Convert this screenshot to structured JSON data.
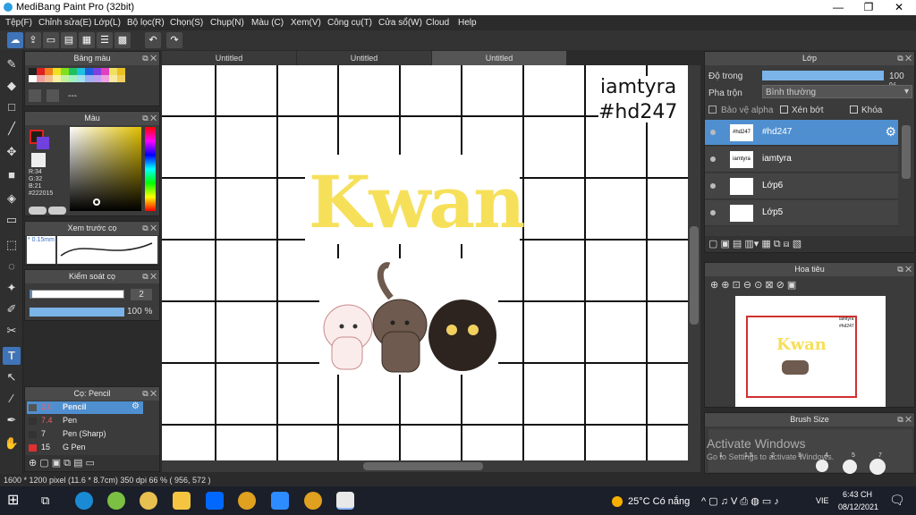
{
  "app": {
    "title": "MediBang Paint Pro (32bit)"
  },
  "window_controls": {
    "minimize": "—",
    "maximize": "❐",
    "close": "✕"
  },
  "menu": [
    "Tệp(F)",
    "Chỉnh sửa(E)",
    "Lớp(L)",
    "Bộ lọc(R)",
    "Chọn(S)",
    "Chụp(N)",
    "Màu (C)",
    "Xem(V)",
    "Công cụ(T)",
    "Cửa sổ(W)",
    "Cloud",
    "Help"
  ],
  "tabs": [
    "Untitled",
    "Untitled",
    "Untitled"
  ],
  "panels": {
    "palette": {
      "title": "Bảng màu",
      "value": "---"
    },
    "color": {
      "title": "Màu",
      "r": "R:34",
      "g": "G:32",
      "b": "B:21",
      "hex": "#222015"
    },
    "preview": {
      "title": "Xem trước cọ",
      "size": "0.15mm"
    },
    "control": {
      "title": "Kiểm soát cọ",
      "size": "2",
      "opacity": "100 %"
    },
    "brushes": {
      "title": "Cọ: Pencil",
      "items": [
        {
          "size": "2.0",
          "name": "Pencil",
          "color": "#555555"
        },
        {
          "size": "7.4",
          "name": "Pen",
          "color": "#333333"
        },
        {
          "size": "7",
          "name": "Pen (Sharp)",
          "color": "#333333"
        },
        {
          "size": "15",
          "name": "G Pen",
          "color": "#e03030"
        }
      ]
    },
    "layer": {
      "title": "Lớp",
      "opacity_label": "Độ trong",
      "opacity_value": "100 %",
      "blend_label": "Pha trộn",
      "blend_value": "Bình thường",
      "protect_alpha": "Bảo vệ alpha",
      "clipping": "Xén bớt",
      "lock": "Khóa",
      "layers": [
        {
          "name": "#hd247",
          "thumb": "#hd247"
        },
        {
          "name": "iamtyra",
          "thumb": "iamtyra"
        },
        {
          "name": "Lớp6",
          "thumb": ""
        },
        {
          "name": "Lớp5",
          "thumb": ""
        }
      ]
    },
    "navigator": {
      "title": "Hoa tiêu"
    },
    "brushsize": {
      "title": "Brush Size",
      "sizes": [
        "1",
        "1.5",
        "2",
        "3",
        "4",
        "5",
        "7"
      ]
    }
  },
  "canvas": {
    "text1": "iamtyra",
    "text2": "#hd247",
    "art_text": "Kwan",
    "nav_text1": "iamtyra",
    "nav_text2": "#hd247",
    "nav_art": "Kwan"
  },
  "status": {
    "text": "1600 * 1200 pixel   (11.6 * 8.7cm)   350 dpi   66 %   ( 956, 572 )"
  },
  "watermark": {
    "line1": "Activate Windows",
    "line2": "Go to Settings to activate Windows."
  },
  "taskbar": {
    "weather": "25°C  Có nắng",
    "lang": "VIE",
    "time": "6:43 CH",
    "date": "08/12/2021"
  },
  "colors": {
    "accent": "#4f8fd0",
    "panel": "#3b3b3b",
    "art_yellow": "#f6e05a"
  }
}
